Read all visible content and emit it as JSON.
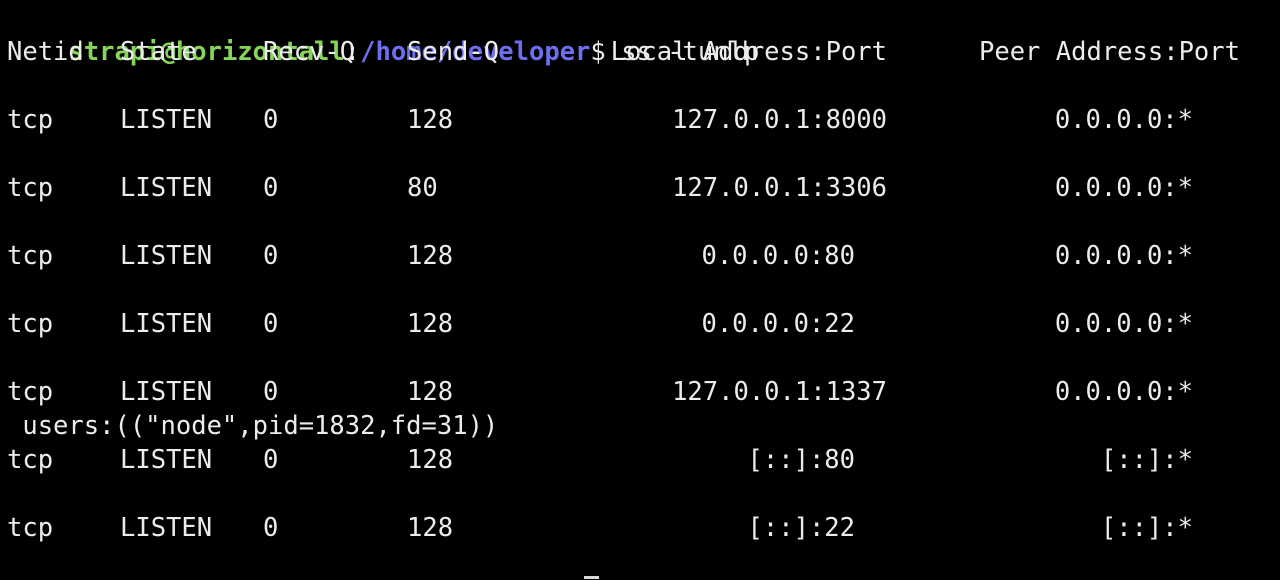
{
  "prompt": {
    "user_host": "strapi@horizontall",
    "separator": ":",
    "path": "/home/developer",
    "dollar": "$",
    "command": " ss -tunlp"
  },
  "headers": {
    "netid": "Netid",
    "state": "State",
    "recvq": "Recv-Q",
    "sendq": "Send-Q",
    "local": "Local Address:Port",
    "peer": "Peer Address:Port"
  },
  "rows": [
    {
      "netid": "tcp",
      "state": "LISTEN",
      "recvq": "0",
      "sendq": "128",
      "local": "127.0.0.1:8000",
      "peer": "0.0.0.0:*"
    },
    {
      "netid": "tcp",
      "state": "LISTEN",
      "recvq": "0",
      "sendq": "80",
      "local": "127.0.0.1:3306",
      "peer": "0.0.0.0:*"
    },
    {
      "netid": "tcp",
      "state": "LISTEN",
      "recvq": "0",
      "sendq": "128",
      "local": "0.0.0.0:80",
      "peer": "0.0.0.0:*"
    },
    {
      "netid": "tcp",
      "state": "LISTEN",
      "recvq": "0",
      "sendq": "128",
      "local": "0.0.0.0:22",
      "peer": "0.0.0.0:*"
    },
    {
      "netid": "tcp",
      "state": "LISTEN",
      "recvq": "0",
      "sendq": "128",
      "local": "127.0.0.1:1337",
      "peer": "0.0.0.0:*",
      "extra": " users:((\"node\",pid=1832,fd=31))"
    },
    {
      "netid": "tcp",
      "state": "LISTEN",
      "recvq": "0",
      "sendq": "128",
      "local": "[::]:80",
      "peer": "[::]:*"
    },
    {
      "netid": "tcp",
      "state": "LISTEN",
      "recvq": "0",
      "sendq": "128",
      "local": "[::]:22",
      "peer": "[::]:*"
    }
  ]
}
